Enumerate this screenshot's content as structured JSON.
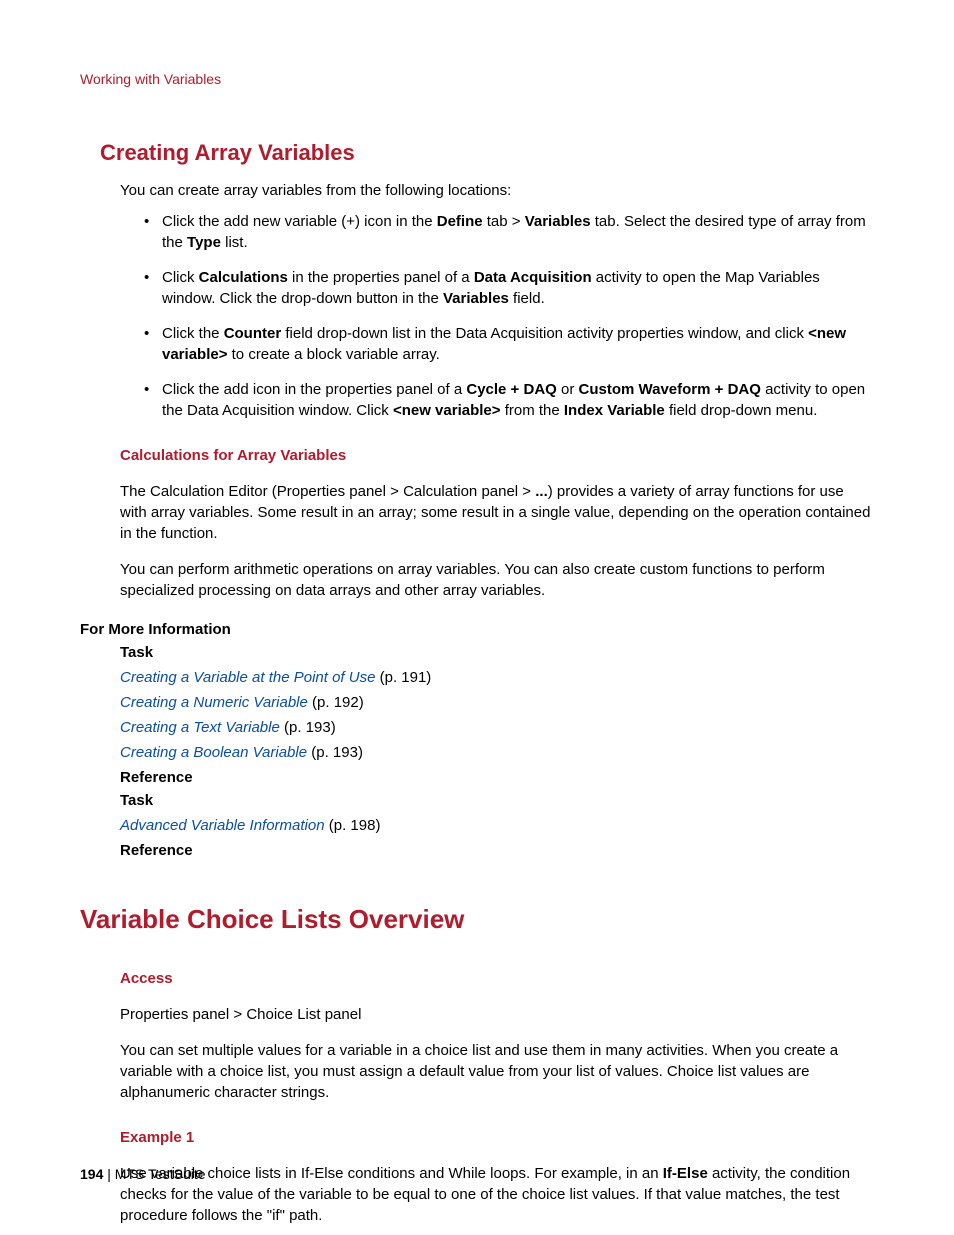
{
  "breadcrumb": "Working with Variables",
  "section1": {
    "title": "Creating Array Variables",
    "intro": "You can create array variables from the following locations:",
    "bullets": {
      "b1": {
        "t1": "Click the add new variable (+) icon in the ",
        "bold1": "Define",
        "t2": " tab > ",
        "bold2": "Variables",
        "t3": " tab. Select the desired type of array from the ",
        "bold3": "Type",
        "t4": " list."
      },
      "b2": {
        "t1": "Click ",
        "bold1": "Calculations",
        "t2": " in the properties panel of a ",
        "bold2": "Data Acquisition",
        "t3": " activity to open the Map Variables window. Click the drop-down button in the ",
        "bold3": "Variables",
        "t4": " field."
      },
      "b3": {
        "t1": "Click the ",
        "bold1": "Counter",
        "t2": " field drop-down list in the Data Acquisition activity properties window, and click ",
        "bold2": "<new variable>",
        "t3": " to create a block variable array."
      },
      "b4": {
        "t1": "Click the add icon in the properties panel of a ",
        "bold1": "Cycle + DAQ",
        "t2": " or ",
        "bold2": "Custom Waveform + DAQ",
        "t3": " activity to open the Data Acquisition window. Click ",
        "bold3": "<new variable>",
        "t4": " from the ",
        "bold4": "Index Variable",
        "t5": " field drop-down menu."
      }
    },
    "calc": {
      "heading": "Calculations for Array Variables",
      "p1a": "The Calculation Editor (Properties panel > Calculation panel > ",
      "p1bold": "...",
      "p1b": ") provides a variety of array functions for use with array variables. Some result in an array; some result in a single value, depending on the operation contained in the function.",
      "p2": "You can perform arithmetic operations on array variables. You can also create custom functions to perform specialized processing on data arrays and other array variables."
    },
    "fmi": {
      "heading": "For More Information",
      "task": "Task",
      "reference": "Reference",
      "links": {
        "l1": {
          "text": "Creating a Variable at the Point of Use",
          "page": "(p. 191)"
        },
        "l2": {
          "text": "Creating a Numeric Variable",
          "page": "(p. 192)"
        },
        "l3": {
          "text": "Creating a Text Variable",
          "page": "(p. 193)"
        },
        "l4": {
          "text": "Creating a Boolean Variable",
          "page": "(p. 193)"
        },
        "l5": {
          "text": "Advanced Variable Information",
          "page": "(p. 198)"
        }
      }
    }
  },
  "section2": {
    "title": "Variable Choice Lists Overview",
    "access": {
      "heading": "Access",
      "text": "Properties panel > Choice List panel"
    },
    "p1": "You can set multiple values for a variable in a choice list and use them in many activities. When you create a variable with a choice list, you must assign a default value from your list of values. Choice list values are alphanumeric character strings.",
    "ex1": {
      "heading": "Example 1",
      "t1": "Use variable choice lists in If-Else conditions and While loops. For example, in an ",
      "bold1": "If-Else",
      "t2": " activity, the condition checks for the value of the variable to be equal to one of the choice list values. If that value matches, the test procedure follows the \"if\" path."
    }
  },
  "footer": {
    "page": "194",
    "sep": " | ",
    "product": "MTS TestSuite"
  }
}
